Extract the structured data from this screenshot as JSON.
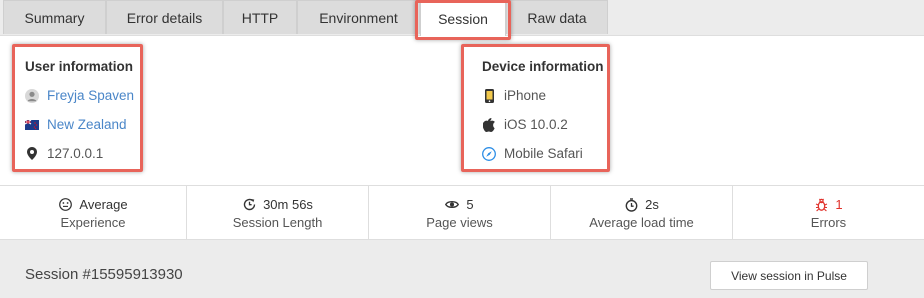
{
  "tabs": [
    {
      "label": "Summary"
    },
    {
      "label": "Error details"
    },
    {
      "label": "HTTP"
    },
    {
      "label": "Environment"
    },
    {
      "label": "Session",
      "active": true
    },
    {
      "label": "Raw data"
    }
  ],
  "user_info": {
    "title": "User information",
    "name": "Freyja Spaven",
    "country": "New Zealand",
    "ip": "127.0.0.1"
  },
  "device_info": {
    "title": "Device information",
    "device": "iPhone",
    "os": "iOS 10.0.2",
    "browser": "Mobile Safari"
  },
  "stats": [
    {
      "value": "Average",
      "label": "Experience",
      "icon": "smiley-icon"
    },
    {
      "value": "30m 56s",
      "label": "Session Length",
      "icon": "clock-arrow-icon"
    },
    {
      "value": "5",
      "label": "Page views",
      "icon": "eye-icon"
    },
    {
      "value": "2s",
      "label": "Average load time",
      "icon": "stopwatch-icon"
    },
    {
      "value": "1",
      "label": "Errors",
      "icon": "bug-icon"
    }
  ],
  "session": {
    "title": "Session #15595913930",
    "button_label": "View session in Pulse"
  },
  "colors": {
    "highlight": "#e8645a",
    "link": "#4a86c8",
    "error": "#e0312b"
  }
}
